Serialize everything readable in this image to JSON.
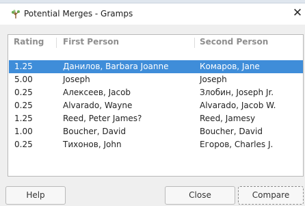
{
  "window": {
    "title": "Potential Merges - Gramps",
    "icon": "gramps-tree-icon",
    "close_glyph": "✕"
  },
  "table": {
    "columns": [
      "Rating",
      "First Person",
      "Second Person"
    ],
    "rows": [
      {
        "rating": "1.25",
        "first": "Данилов, Barbara Joanne",
        "second": "Комаров, Jane",
        "selected": true
      },
      {
        "rating": "5.00",
        "first": "Joseph",
        "second": "Joseph"
      },
      {
        "rating": "0.25",
        "first": "Алексеев, Jacob",
        "second": "Злобин, Joseph Jr."
      },
      {
        "rating": "0.25",
        "first": "Alvarado, Wayne",
        "second": "Alvarado, Jacob W."
      },
      {
        "rating": "1.25",
        "first": "Reed, Peter James?",
        "second": "Reed, Jamesy"
      },
      {
        "rating": "1.00",
        "first": "Boucher, David",
        "second": "Boucher, David"
      },
      {
        "rating": "0.25",
        "first": "Тихонов, John",
        "second": "Егоров, Charles J."
      }
    ]
  },
  "buttons": {
    "help": "Help",
    "close": "Close",
    "compare": "Compare"
  },
  "colors": {
    "selection": "#3f8dd9",
    "header_text": "#8e8e8e"
  }
}
